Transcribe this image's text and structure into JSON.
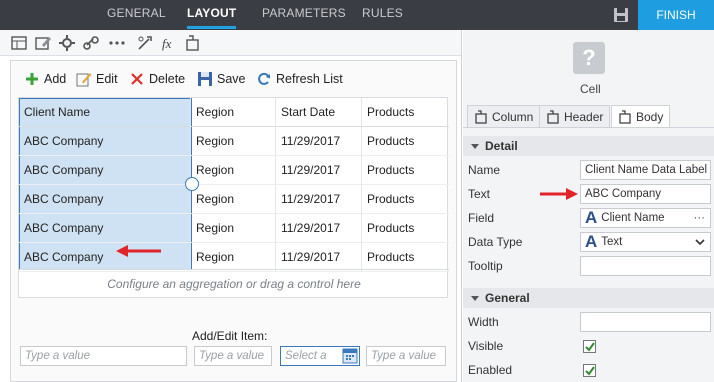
{
  "topbar": {
    "tabs": [
      {
        "label": "GENERAL",
        "active": false
      },
      {
        "label": "LAYOUT",
        "active": true
      },
      {
        "label": "PARAMETERS",
        "active": false
      },
      {
        "label": "RULES",
        "active": false
      }
    ],
    "finish_label": "FINISH"
  },
  "actions": {
    "add": "Add",
    "edit": "Edit",
    "delete": "Delete",
    "save": "Save",
    "refresh": "Refresh List"
  },
  "table": {
    "headers": [
      "Client Name",
      "Region",
      "Start Date",
      "Products"
    ],
    "rows": [
      [
        "ABC Company",
        "Region",
        "11/29/2017",
        "Products"
      ],
      [
        "ABC Company",
        "Region",
        "11/29/2017",
        "Products"
      ],
      [
        "ABC Company",
        "Region",
        "11/29/2017",
        "Products"
      ],
      [
        "ABC Company",
        "Region",
        "11/29/2017",
        "Products"
      ],
      [
        "ABC Company",
        "Region",
        "11/29/2017",
        "Products"
      ]
    ],
    "aggregation_hint": "Configure an aggregation or drag a control here"
  },
  "addedit": {
    "label": "Add/Edit Item:",
    "placeholders": [
      "Type a value",
      "Type a value",
      "Select a",
      "Type a value"
    ]
  },
  "properties": {
    "control_name": "Cell",
    "tabs": [
      "Column",
      "Header",
      "Body"
    ],
    "active_tab": "Body",
    "detail": {
      "title": "Detail",
      "name_label": "Name",
      "name_value": "Client Name Data Label",
      "text_label": "Text",
      "text_value": "ABC Company",
      "field_label": "Field",
      "field_value": "Client Name",
      "field_more": "···",
      "datatype_label": "Data Type",
      "datatype_value": "Text",
      "tooltip_label": "Tooltip",
      "tooltip_value": ""
    },
    "general": {
      "title": "General",
      "width_label": "Width",
      "width_value": "",
      "visible_label": "Visible",
      "visible_checked": true,
      "enabled_label": "Enabled",
      "enabled_checked": true
    }
  },
  "colors": {
    "topbar_bg": "#3a3d44",
    "accent": "#1e9de0",
    "selection": "#cfe2f3",
    "annotation_arrow": "#e0242a"
  }
}
